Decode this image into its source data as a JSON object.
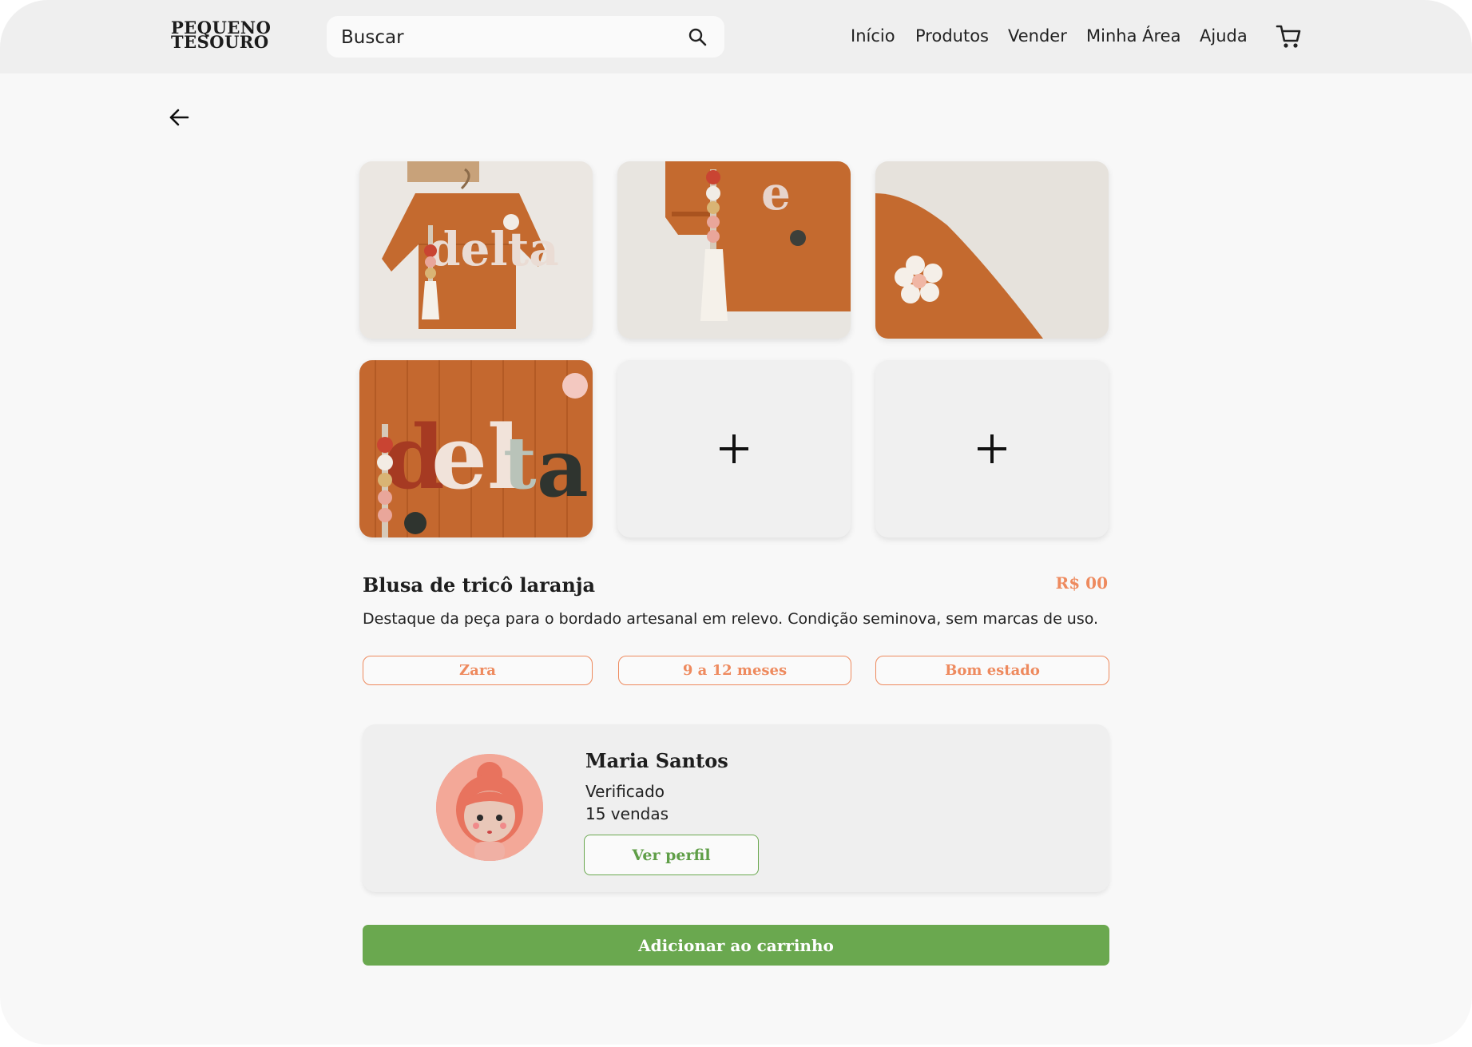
{
  "header": {
    "logo_line1": "PEQUENO",
    "logo_line2": "TESOURO",
    "search_placeholder": "Buscar",
    "nav": [
      "Início",
      "Produtos",
      "Vender",
      "Minha Área",
      "Ajuda"
    ]
  },
  "icons": {
    "search": "search-icon",
    "cart": "cart-icon",
    "back": "arrow-left-icon",
    "add": "plus-icon"
  },
  "gallery": {
    "photos": 4,
    "add_slots": 2
  },
  "product": {
    "title": "Blusa de tricô laranja",
    "price": "R$ 00",
    "description": "Destaque da peça para o bordado artesanal em relevo. Condição seminova, sem marcas de uso.",
    "tags": [
      "Zara",
      "9 a 12 meses",
      "Bom estado"
    ]
  },
  "seller": {
    "name": "Maria Santos",
    "status": "Verificado",
    "sales": "15 vendas",
    "profile_button": "Ver perfil"
  },
  "actions": {
    "add_to_cart": "Adicionar ao carrinho"
  },
  "colors": {
    "accent_orange": "#ee8a5e",
    "accent_green": "#6aa84f",
    "header_bg": "#efefef",
    "page_bg": "#f8f8f8"
  }
}
